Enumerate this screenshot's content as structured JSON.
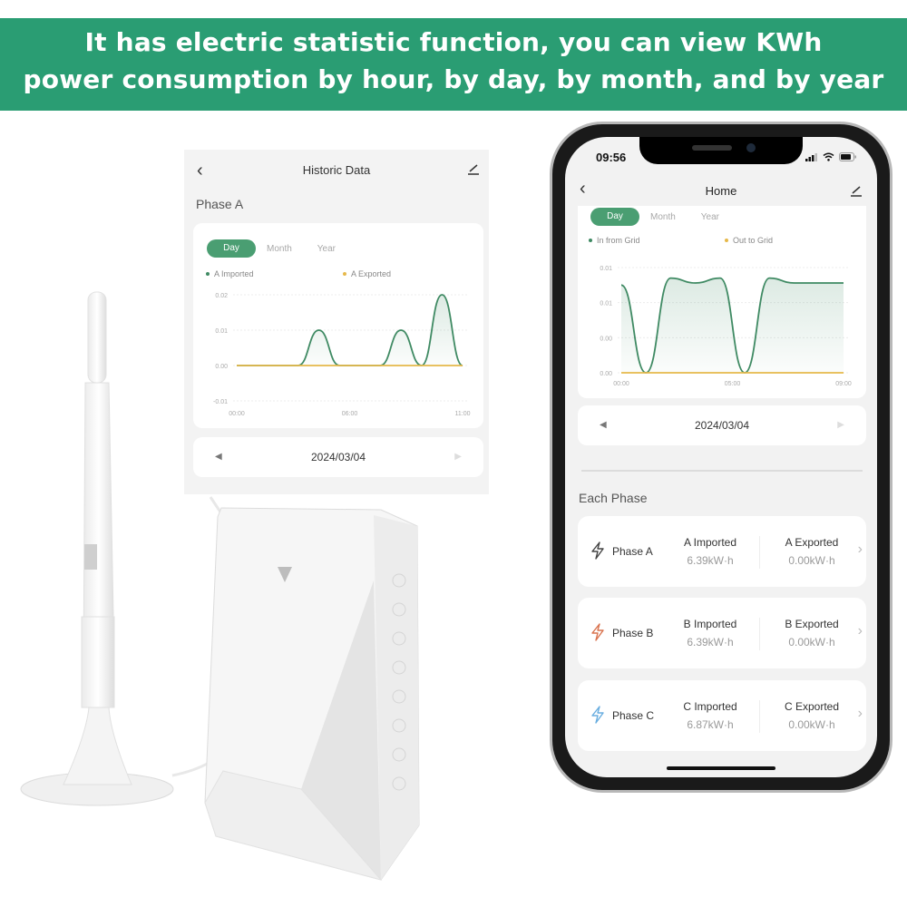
{
  "banner": {
    "line1": "It has electric statistic function, you can view KWh",
    "line2": "power consumption by hour, by day, by month, and by year",
    "bg_color": "#2a9d73"
  },
  "historic_screen": {
    "back_icon": "chevron-left-icon",
    "title": "Historic Data",
    "edit_icon": "pencil-icon",
    "section_title": "Phase A",
    "tabs": [
      {
        "label": "Day",
        "active": true
      },
      {
        "label": "Month",
        "active": false
      },
      {
        "label": "Year",
        "active": false
      }
    ],
    "date": "2024/03/04",
    "prev_icon": "triangle-left-icon",
    "next_icon": "triangle-right-icon"
  },
  "phone": {
    "status_time": "09:56",
    "status_icons": [
      "signal-icon",
      "wifi-icon",
      "battery-icon"
    ],
    "title": "Home",
    "tabs": [
      {
        "label": "Day",
        "active": true
      },
      {
        "label": "Month",
        "active": false
      },
      {
        "label": "Year",
        "active": false
      }
    ],
    "date": "2024/03/04",
    "each_phase_title": "Each Phase",
    "phases": [
      {
        "name": "Phase A",
        "icon_color": "#444444",
        "imported_label": "A Imported",
        "imported_value": "6.39kW·h",
        "exported_label": "A Exported",
        "exported_value": "0.00kW·h"
      },
      {
        "name": "Phase B",
        "icon_color": "#d9734e",
        "imported_label": "B Imported",
        "imported_value": "6.39kW·h",
        "exported_label": "B Exported",
        "exported_value": "0.00kW·h"
      },
      {
        "name": "Phase C",
        "icon_color": "#6aaee0",
        "imported_label": "C Imported",
        "imported_value": "6.87kW·h",
        "exported_label": "C Exported",
        "exported_value": "0.00kW·h"
      }
    ]
  },
  "chart_data": [
    {
      "type": "line",
      "title": "Phase A",
      "series": [
        {
          "name": "A Imported",
          "color": "#3f8a63",
          "x": [
            0,
            1,
            2,
            3,
            4,
            5,
            6,
            7,
            8,
            9,
            10,
            11
          ],
          "values": [
            0,
            0,
            0,
            0,
            0.01,
            0,
            0,
            0,
            0.01,
            0,
            0.02,
            0
          ]
        },
        {
          "name": "A Exported",
          "color": "#e6b84a",
          "x": [
            0,
            1,
            2,
            3,
            4,
            5,
            6,
            7,
            8,
            9,
            10,
            11
          ],
          "values": [
            0,
            0,
            0,
            0,
            0,
            0,
            0,
            0,
            0,
            0,
            0,
            0
          ]
        }
      ],
      "x_ticks": [
        "00:00",
        "06:00",
        "11:00"
      ],
      "y_ticks": [
        "0.02",
        "0.01",
        "0.00",
        "-0.01"
      ],
      "ylim": [
        -0.01,
        0.02
      ],
      "legend": "top",
      "grid": true
    },
    {
      "type": "line",
      "title": "Home",
      "series": [
        {
          "name": "In from Grid",
          "color": "#3f8a63",
          "x": [
            0,
            1,
            2,
            3,
            4,
            5,
            6,
            7,
            8,
            9
          ],
          "values": [
            0.0125,
            0,
            0.0135,
            0.0128,
            0.0135,
            0,
            0.0135,
            0.0128,
            0.0128,
            0.0128
          ]
        },
        {
          "name": "Out to Grid",
          "color": "#e6b84a",
          "x": [
            0,
            1,
            2,
            3,
            4,
            5,
            6,
            7,
            8,
            9
          ],
          "values": [
            0,
            0,
            0,
            0,
            0,
            0,
            0,
            0,
            0,
            0
          ]
        }
      ],
      "x_ticks": [
        "00:00",
        "05:00",
        "09:00"
      ],
      "y_ticks": [
        "0.01",
        "0.01",
        "0.00",
        "0.00"
      ],
      "ylim": [
        0,
        0.015
      ],
      "legend": "top",
      "grid": true
    }
  ]
}
